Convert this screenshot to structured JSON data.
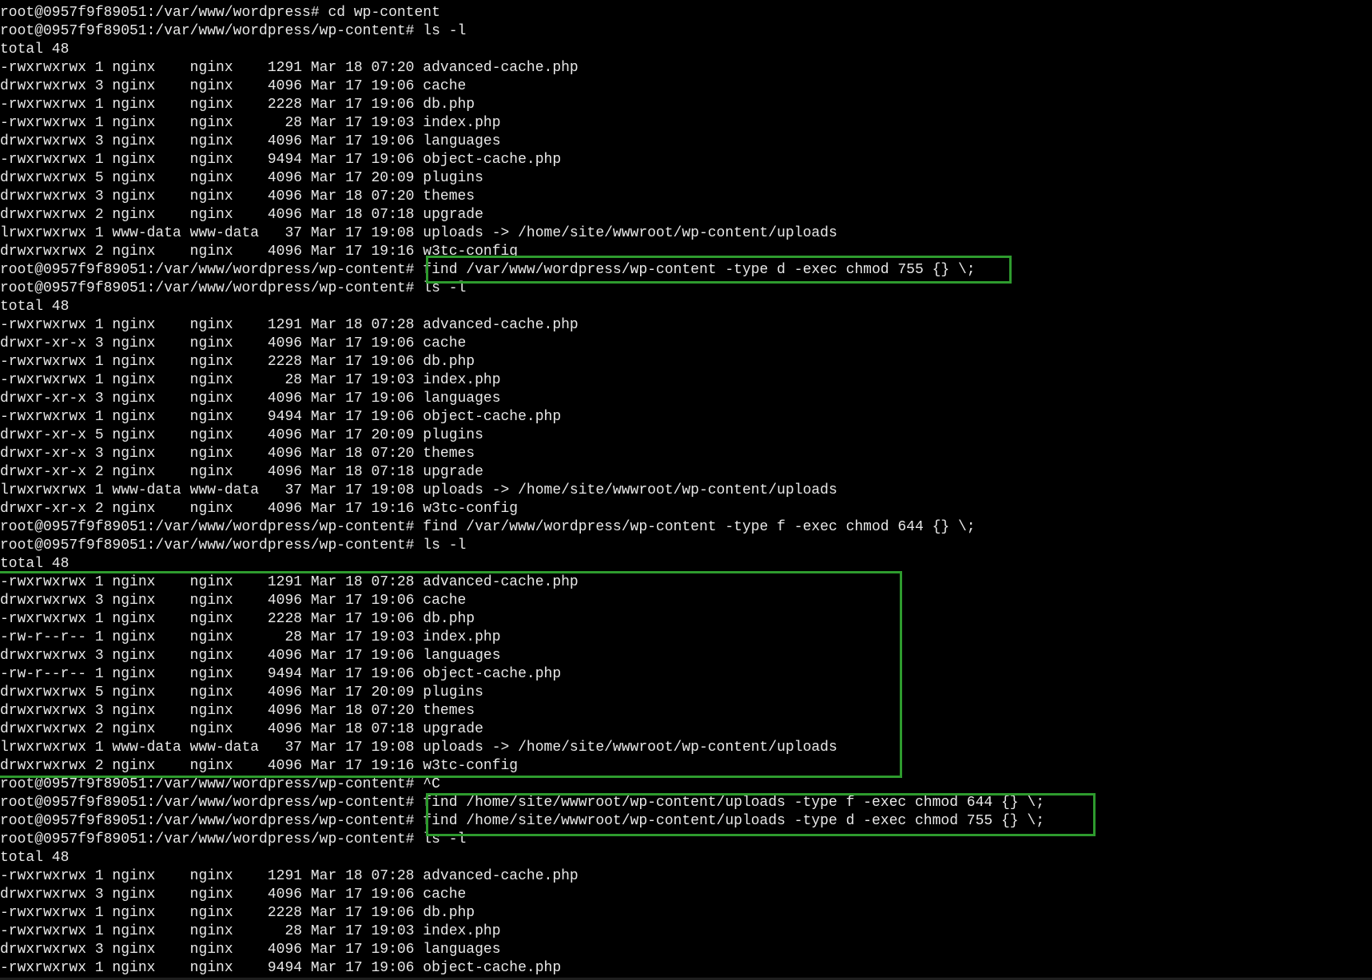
{
  "terminal": {
    "lines": [
      "root@0957f9f89051:/var/www/wordpress# cd wp-content",
      "root@0957f9f89051:/var/www/wordpress/wp-content# ls -l",
      "total 48",
      "-rwxrwxrwx 1 nginx    nginx    1291 Mar 18 07:20 advanced-cache.php",
      "drwxrwxrwx 3 nginx    nginx    4096 Mar 17 19:06 cache",
      "-rwxrwxrwx 1 nginx    nginx    2228 Mar 17 19:06 db.php",
      "-rwxrwxrwx 1 nginx    nginx      28 Mar 17 19:03 index.php",
      "drwxrwxrwx 3 nginx    nginx    4096 Mar 17 19:06 languages",
      "-rwxrwxrwx 1 nginx    nginx    9494 Mar 17 19:06 object-cache.php",
      "drwxrwxrwx 5 nginx    nginx    4096 Mar 17 20:09 plugins",
      "drwxrwxrwx 3 nginx    nginx    4096 Mar 18 07:20 themes",
      "drwxrwxrwx 2 nginx    nginx    4096 Mar 18 07:18 upgrade",
      "lrwxrwxrwx 1 www-data www-data   37 Mar 17 19:08 uploads -> /home/site/wwwroot/wp-content/uploads",
      "drwxrwxrwx 2 nginx    nginx    4096 Mar 17 19:16 w3tc-config",
      "root@0957f9f89051:/var/www/wordpress/wp-content# find /var/www/wordpress/wp-content -type d -exec chmod 755 {} \\;",
      "root@0957f9f89051:/var/www/wordpress/wp-content# ls -l",
      "total 48",
      "-rwxrwxrwx 1 nginx    nginx    1291 Mar 18 07:28 advanced-cache.php",
      "drwxr-xr-x 3 nginx    nginx    4096 Mar 17 19:06 cache",
      "-rwxrwxrwx 1 nginx    nginx    2228 Mar 17 19:06 db.php",
      "-rwxrwxrwx 1 nginx    nginx      28 Mar 17 19:03 index.php",
      "drwxr-xr-x 3 nginx    nginx    4096 Mar 17 19:06 languages",
      "-rwxrwxrwx 1 nginx    nginx    9494 Mar 17 19:06 object-cache.php",
      "drwxr-xr-x 5 nginx    nginx    4096 Mar 17 20:09 plugins",
      "drwxr-xr-x 3 nginx    nginx    4096 Mar 18 07:20 themes",
      "drwxr-xr-x 2 nginx    nginx    4096 Mar 18 07:18 upgrade",
      "lrwxrwxrwx 1 www-data www-data   37 Mar 17 19:08 uploads -> /home/site/wwwroot/wp-content/uploads",
      "drwxr-xr-x 2 nginx    nginx    4096 Mar 17 19:16 w3tc-config",
      "root@0957f9f89051:/var/www/wordpress/wp-content# find /var/www/wordpress/wp-content -type f -exec chmod 644 {} \\;",
      "root@0957f9f89051:/var/www/wordpress/wp-content# ls -l",
      "total 48",
      "-rwxrwxrwx 1 nginx    nginx    1291 Mar 18 07:28 advanced-cache.php",
      "drwxrwxrwx 3 nginx    nginx    4096 Mar 17 19:06 cache",
      "-rwxrwxrwx 1 nginx    nginx    2228 Mar 17 19:06 db.php",
      "-rw-r--r-- 1 nginx    nginx      28 Mar 17 19:03 index.php",
      "drwxrwxrwx 3 nginx    nginx    4096 Mar 17 19:06 languages",
      "-rw-r--r-- 1 nginx    nginx    9494 Mar 17 19:06 object-cache.php",
      "drwxrwxrwx 5 nginx    nginx    4096 Mar 17 20:09 plugins",
      "drwxrwxrwx 3 nginx    nginx    4096 Mar 18 07:20 themes",
      "drwxrwxrwx 2 nginx    nginx    4096 Mar 18 07:18 upgrade",
      "lrwxrwxrwx 1 www-data www-data   37 Mar 17 19:08 uploads -> /home/site/wwwroot/wp-content/uploads",
      "drwxrwxrwx 2 nginx    nginx    4096 Mar 17 19:16 w3tc-config",
      "root@0957f9f89051:/var/www/wordpress/wp-content# ^C",
      "root@0957f9f89051:/var/www/wordpress/wp-content# find /home/site/wwwroot/wp-content/uploads -type f -exec chmod 644 {} \\;",
      "root@0957f9f89051:/var/www/wordpress/wp-content# find /home/site/wwwroot/wp-content/uploads -type d -exec chmod 755 {} \\;",
      "root@0957f9f89051:/var/www/wordpress/wp-content# ls -l",
      "total 48",
      "-rwxrwxrwx 1 nginx    nginx    1291 Mar 18 07:28 advanced-cache.php",
      "drwxrwxrwx 3 nginx    nginx    4096 Mar 17 19:06 cache",
      "-rwxrwxrwx 1 nginx    nginx    2228 Mar 17 19:06 db.php",
      "-rwxrwxrwx 1 nginx    nginx      28 Mar 17 19:03 index.php",
      "drwxrwxrwx 3 nginx    nginx    4096 Mar 17 19:06 languages",
      "-rwxrwxrwx 1 nginx    nginx    9494 Mar 17 19:06 object-cache.php"
    ]
  },
  "colors": {
    "background": "#000000",
    "text": "#e8e8e8",
    "highlight_border": "#2e9b2e"
  }
}
